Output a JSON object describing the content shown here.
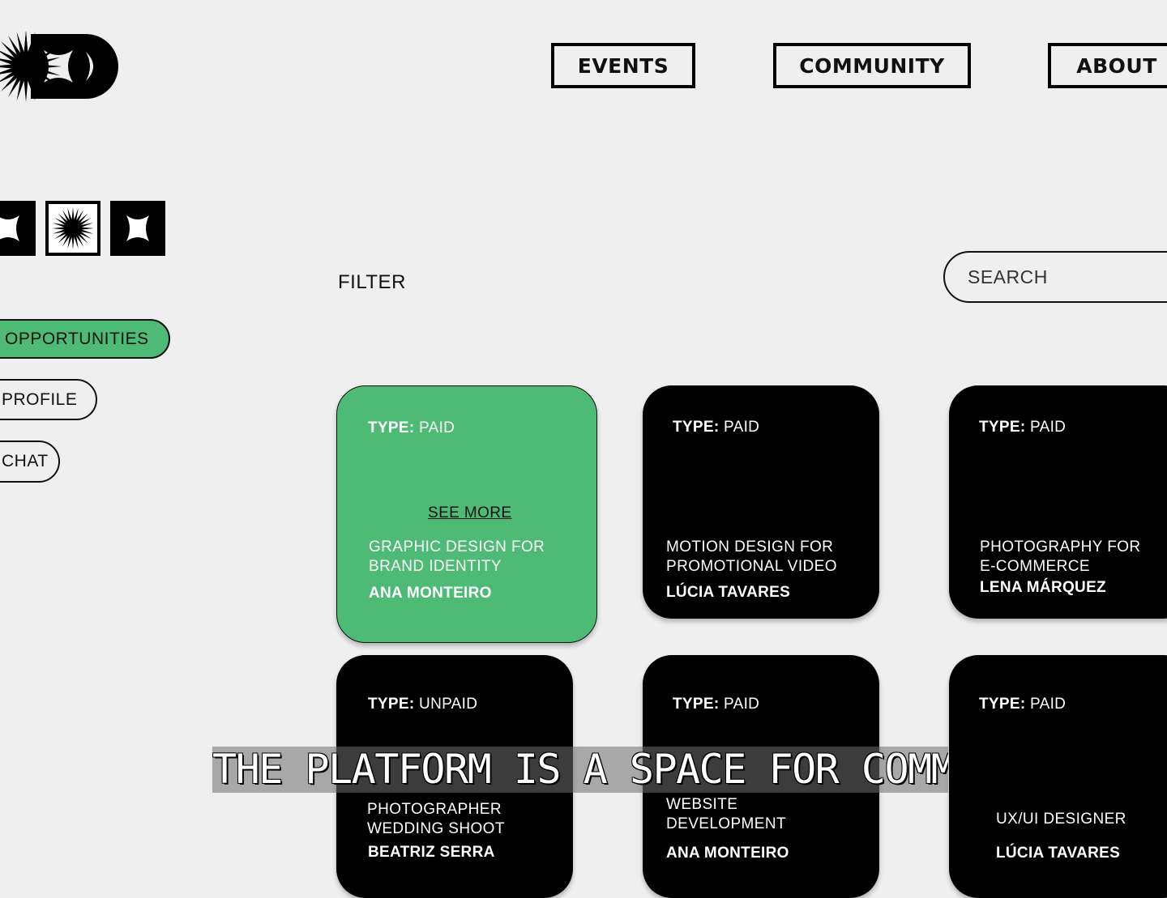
{
  "brand": {
    "logo_icon": "burst-star-logo-icon"
  },
  "nav": [
    {
      "label": "EVENTS"
    },
    {
      "label": "COMMUNITY"
    },
    {
      "label": "ABOUT"
    }
  ],
  "icon_row": [
    "star-blob-icon",
    "burst-icon",
    "star-blob-icon"
  ],
  "sidebar": {
    "items": [
      {
        "label": "OPPORTUNITIES",
        "active": true
      },
      {
        "label": "PROFILE",
        "active": false
      },
      {
        "label": "CHAT",
        "active": false
      }
    ]
  },
  "filter": {
    "label": "FILTER"
  },
  "search": {
    "placeholder": "SEARCH"
  },
  "cards": [
    {
      "type_label": "TYPE:",
      "type_value": "PAID",
      "title": "GRAPHIC DESIGN FOR\nBRAND IDENTITY",
      "author": "ANA MONTEIRO",
      "see_more": "SEE MORE",
      "highlighted": true
    },
    {
      "type_label": "TYPE:",
      "type_value": "PAID",
      "title": "MOTION DESIGN FOR\nPROMOTIONAL VIDEO",
      "author": "LÚCIA TAVARES"
    },
    {
      "type_label": "TYPE:",
      "type_value": "PAID",
      "title": "PHOTOGRAPHY FOR\n E-COMMERCE",
      "author": "LENA MÁRQUEZ"
    },
    {
      "type_label": "TYPE:",
      "type_value": "UNPAID",
      "title": "PHOTOGRAPHER\nWEDDING SHOOT",
      "author": "BEATRIZ SERRA"
    },
    {
      "type_label": "TYPE:",
      "type_value": "PAID",
      "title": "WEBSITE\nDEVELOPMENT",
      "author": "ANA MONTEIRO"
    },
    {
      "type_label": "TYPE:",
      "type_value": "PAID",
      "title": "UX/UI DESIGNER",
      "author": "LÚCIA TAVARES"
    }
  ],
  "subtitle": {
    "text": "THE PLATFORM IS A SPACE FOR COMMUNITY,"
  },
  "colors": {
    "accent": "#4dbb76",
    "background": "#efefef",
    "card": "#000000"
  }
}
